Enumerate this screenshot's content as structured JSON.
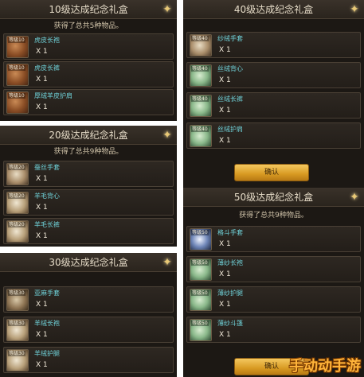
{
  "panels": [
    {
      "title": "10级达成纪念礼盒",
      "subtitle": "获得了总共5种物品。",
      "items": [
        {
          "level": "等级10",
          "name": "虎皮长袍",
          "qty": "X 1"
        },
        {
          "level": "等级10",
          "name": "虎皮长裤",
          "qty": "X 1"
        },
        {
          "level": "等级10",
          "name": "厚绒羊皮护肩",
          "qty": "X 1"
        }
      ]
    },
    {
      "title": "40级达成纪念礼盒",
      "subtitle": "",
      "items": [
        {
          "level": "等级40",
          "name": "纱绒手套",
          "qty": "X 1"
        },
        {
          "level": "等级40",
          "name": "丝绒背心",
          "qty": "X 1"
        },
        {
          "level": "等级40",
          "name": "丝绒长裤",
          "qty": "X 1"
        },
        {
          "level": "等级40",
          "name": "丝绒护肩",
          "qty": "X 1"
        }
      ],
      "confirm_label": "确认"
    },
    {
      "title": "20级达成纪念礼盒",
      "subtitle": "获得了总共9种物品。",
      "items": [
        {
          "level": "等级20",
          "name": "蚕丝手套",
          "qty": "X 1"
        },
        {
          "level": "等级20",
          "name": "羊毛背心",
          "qty": "X 1"
        },
        {
          "level": "等级20",
          "name": "羊毛长裤",
          "qty": "X 1"
        }
      ]
    },
    {
      "title": "50级达成纪念礼盒",
      "subtitle": "获得了总共9种物品。",
      "items": [
        {
          "level": "等级50",
          "name": "格斗手套",
          "qty": "X 1"
        },
        {
          "level": "等级50",
          "name": "薄纱长袍",
          "qty": "X 1"
        },
        {
          "level": "等级50",
          "name": "薄纱护腿",
          "qty": "X 1"
        },
        {
          "level": "等级50",
          "name": "薄纱斗篷",
          "qty": "X 1"
        }
      ],
      "confirm_label": "确认"
    },
    {
      "title": "30级达成纪念礼盒",
      "subtitle": "",
      "items": [
        {
          "level": "等级30",
          "name": "亚麻手套",
          "qty": "X 1"
        },
        {
          "level": "等级30",
          "name": "羊绒长袍",
          "qty": "X 1"
        },
        {
          "level": "等级30",
          "name": "羊绒护腿",
          "qty": "X 1"
        }
      ]
    }
  ],
  "icons": [
    "star-icon",
    "item-icon"
  ],
  "watermark": "手动动手游",
  "colors": {
    "item_name": "#6fd1d8",
    "title": "#e6dcc8",
    "button": "#d89a22"
  }
}
